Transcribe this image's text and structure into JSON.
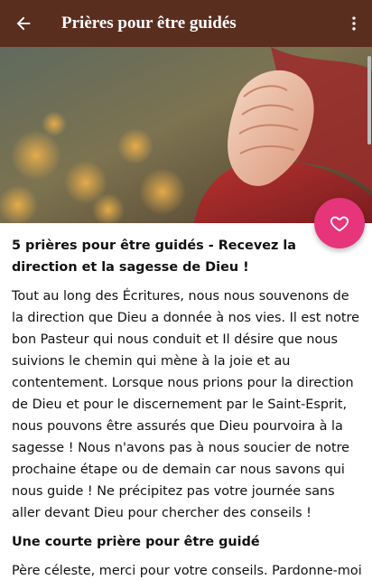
{
  "appbar": {
    "title": "Prières pour être guidés",
    "back_icon": "arrow-back-icon",
    "menu_icon": "more-vert-icon",
    "background": "#5a2e1f"
  },
  "hero": {
    "image_description_icon": "praying-hands-photo"
  },
  "fab": {
    "icon": "heart-outline-icon",
    "color": "#e6357a"
  },
  "article": {
    "heading": "5 prières pour être guidés - Recevez la direction et la sagesse de Dieu !",
    "paragraph_1": "Tout au long des Écritures, nous nous souvenons de la direction que Dieu a donnée à nos vies. Il est notre bon Pasteur qui nous conduit et Il désire que nous suivions le chemin qui mène à la joie et au contentement. Lorsque nous prions pour la direction de Dieu et pour le discernement par le Saint-Esprit, nous pouvons être assurés que Dieu pourvoira à la sagesse ! Nous n'avons pas à nous soucier de notre prochaine étape ou de demain car nous savons qui nous guide ! Ne précipitez pas votre journée sans aller devant Dieu pour chercher des conseils !",
    "subheading": "Une courte prière pour être guidé",
    "paragraph_2": "Père céleste, merci pour votre conseils. Pardonne-moi"
  }
}
